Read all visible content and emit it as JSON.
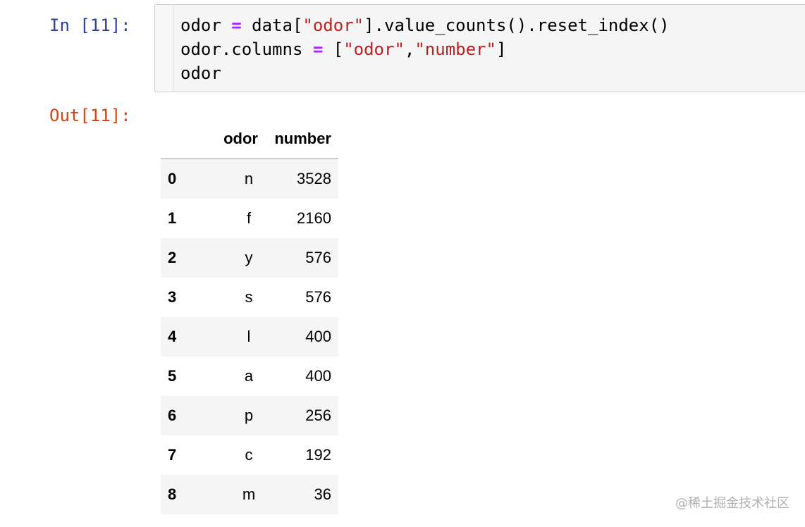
{
  "cell": {
    "in_prompt": "In [11]:",
    "out_prompt": "Out[11]:",
    "code_lines": [
      "odor = data[\"odor\"].value_counts().reset_index()",
      "odor.columns = [\"odor\",\"number\"]",
      "odor"
    ]
  },
  "dataframe": {
    "columns": [
      "odor",
      "number"
    ],
    "rows": [
      {
        "index": "0",
        "odor": "n",
        "number": "3528"
      },
      {
        "index": "1",
        "odor": "f",
        "number": "2160"
      },
      {
        "index": "2",
        "odor": "y",
        "number": "576"
      },
      {
        "index": "3",
        "odor": "s",
        "number": "576"
      },
      {
        "index": "4",
        "odor": "l",
        "number": "400"
      },
      {
        "index": "5",
        "odor": "a",
        "number": "400"
      },
      {
        "index": "6",
        "odor": "p",
        "number": "256"
      },
      {
        "index": "7",
        "odor": "c",
        "number": "192"
      },
      {
        "index": "8",
        "odor": "m",
        "number": "36"
      }
    ]
  },
  "watermark": "@稀土掘金技术社区",
  "colors": {
    "in_prompt": "#303f9f",
    "out_prompt": "#d84315",
    "code_operator": "#aa22ff",
    "code_string": "#ba2121",
    "input_background": "#f5f5f5",
    "row_stripe": "#f5f5f5"
  }
}
